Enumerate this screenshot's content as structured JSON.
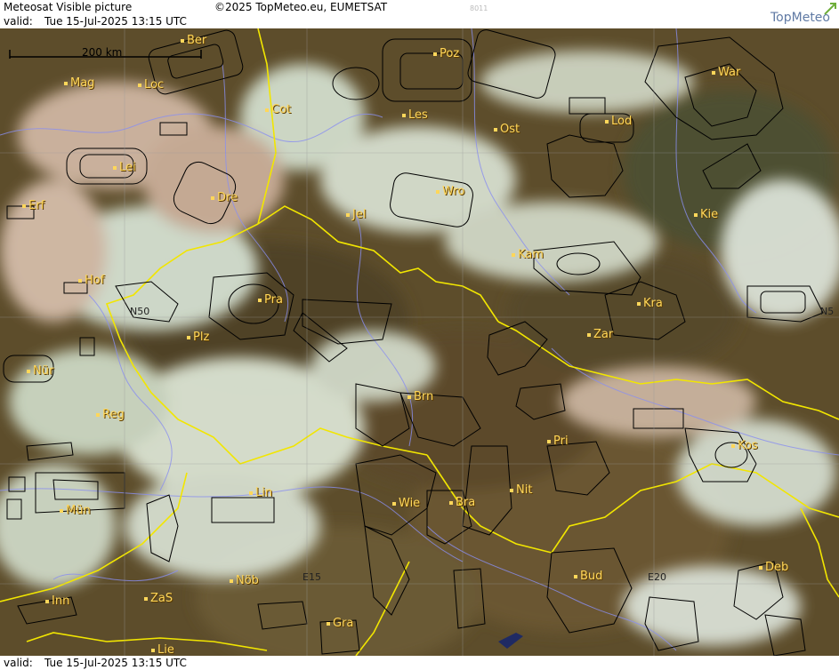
{
  "header": {
    "product": "Meteosat Visible picture",
    "copyright": "©2025 TopMeteo.eu, EUMETSAT",
    "image_id": "8011",
    "valid_prefix": "valid:",
    "valid_time": "Tue  15-Jul-2025  13:15 UTC",
    "logo": "TopMeteo"
  },
  "scale_bar": {
    "label": "200 km"
  },
  "grid_labels": {
    "lat": "N50",
    "lat_right": "N5",
    "lon1": "E15",
    "lon2": "E20"
  },
  "cities": [
    {
      "id": "ber",
      "label": "Ber"
    },
    {
      "id": "mag",
      "label": "Mag"
    },
    {
      "id": "loc",
      "label": "Loc"
    },
    {
      "id": "cot",
      "label": "Cot"
    },
    {
      "id": "poz",
      "label": "Poz"
    },
    {
      "id": "les",
      "label": "Les"
    },
    {
      "id": "ost",
      "label": "Ost"
    },
    {
      "id": "lod",
      "label": "Lod"
    },
    {
      "id": "war",
      "label": "War"
    },
    {
      "id": "lei",
      "label": "Lei"
    },
    {
      "id": "dre",
      "label": "Dre"
    },
    {
      "id": "erf",
      "label": "Erf"
    },
    {
      "id": "jel",
      "label": "Jel"
    },
    {
      "id": "wro",
      "label": "Wro"
    },
    {
      "id": "kie",
      "label": "Kie"
    },
    {
      "id": "kam",
      "label": "Kam"
    },
    {
      "id": "hof",
      "label": "Hof"
    },
    {
      "id": "pra",
      "label": "Pra"
    },
    {
      "id": "kra",
      "label": "Kra"
    },
    {
      "id": "plz",
      "label": "Plz"
    },
    {
      "id": "zar",
      "label": "Zar"
    },
    {
      "id": "nur",
      "label": "Nür"
    },
    {
      "id": "brn",
      "label": "Brn"
    },
    {
      "id": "reg",
      "label": "Reg"
    },
    {
      "id": "pri",
      "label": "Pri"
    },
    {
      "id": "kos",
      "label": "Kos"
    },
    {
      "id": "lin",
      "label": "Lin"
    },
    {
      "id": "nit",
      "label": "Nit"
    },
    {
      "id": "wie",
      "label": "Wie"
    },
    {
      "id": "bra",
      "label": "Bra"
    },
    {
      "id": "mun",
      "label": "Mün"
    },
    {
      "id": "nob",
      "label": "Nöb"
    },
    {
      "id": "bud",
      "label": "Bud"
    },
    {
      "id": "deb",
      "label": "Deb"
    },
    {
      "id": "inn",
      "label": "Inn"
    },
    {
      "id": "zas",
      "label": "ZaS"
    },
    {
      "id": "gra",
      "label": "Gra"
    },
    {
      "id": "lie",
      "label": "Lie"
    }
  ],
  "colors": {
    "city_label": "#ffd75a",
    "border": "#f2e600",
    "river": "#8a8ff0",
    "airspace": "#000000",
    "logo": "#607aa4"
  }
}
